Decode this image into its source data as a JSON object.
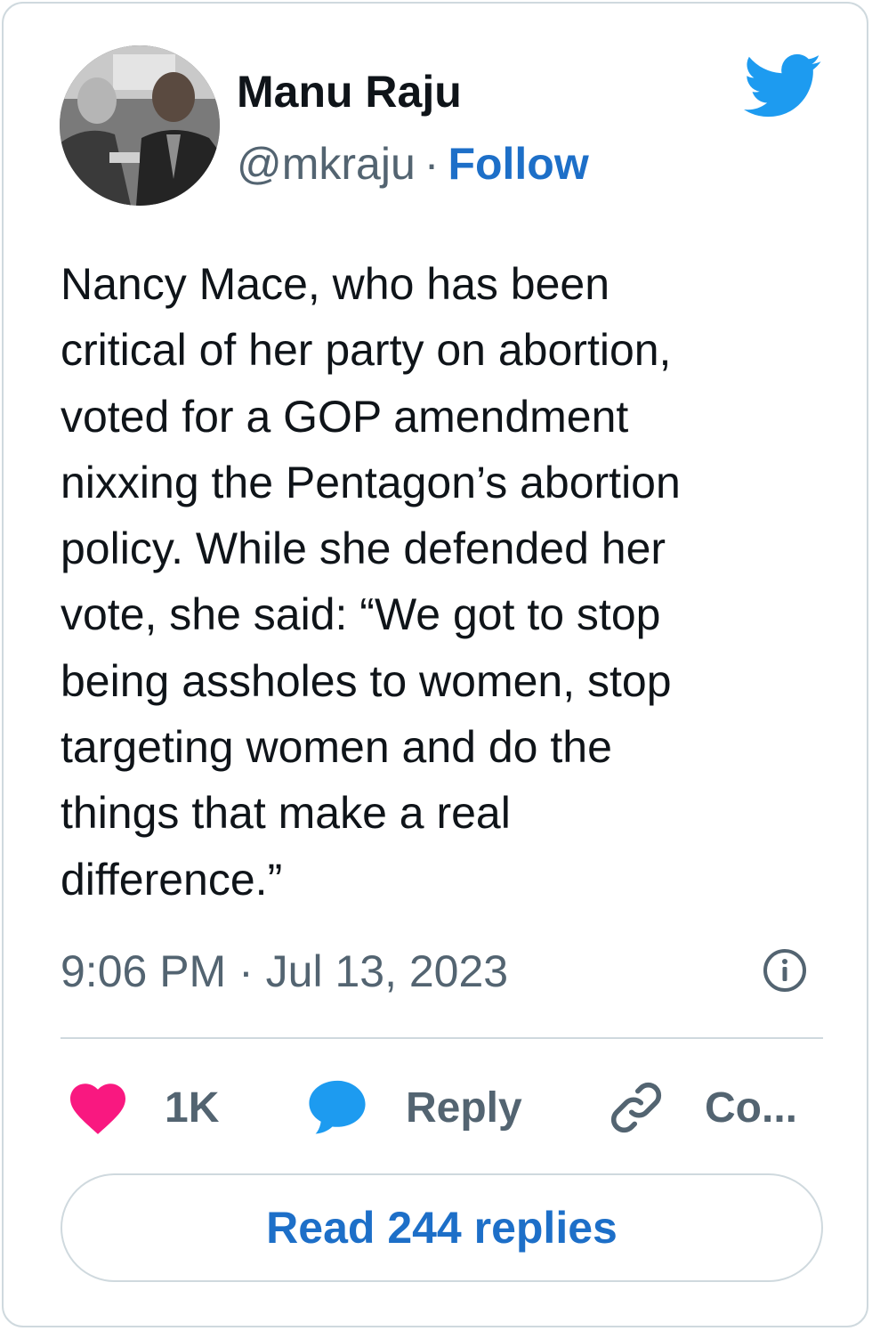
{
  "author": {
    "name": "Manu Raju",
    "handle": "@mkraju",
    "separator": "·",
    "follow_label": "Follow"
  },
  "tweet": {
    "lines": [
      "Nancy Mace, who has been",
      "critical of her party on abortion,",
      "voted for a GOP amendment",
      "nixxing the Pentagon’s abortion",
      "policy. While she defended her",
      "vote, she said: “We got to stop",
      "being assholes to women, stop",
      "targeting women and do the",
      "things that make a real",
      "difference.”"
    ],
    "timestamp": "9:06 PM · Jul 13, 2023"
  },
  "actions": {
    "likes_count": "1K",
    "reply_label": "Reply",
    "copy_label": "Co..."
  },
  "read_replies_label": "Read 244 replies",
  "icons": {
    "brand": "twitter-bird-icon",
    "info": "info-icon",
    "like": "heart-icon",
    "reply": "speech-bubble-icon",
    "copy": "link-icon"
  },
  "colors": {
    "brand_blue": "#1d9bf0",
    "link_blue": "#1d6fc8",
    "heart_pink": "#f91880",
    "muted_text": "#536471",
    "border": "#cfd9de"
  }
}
